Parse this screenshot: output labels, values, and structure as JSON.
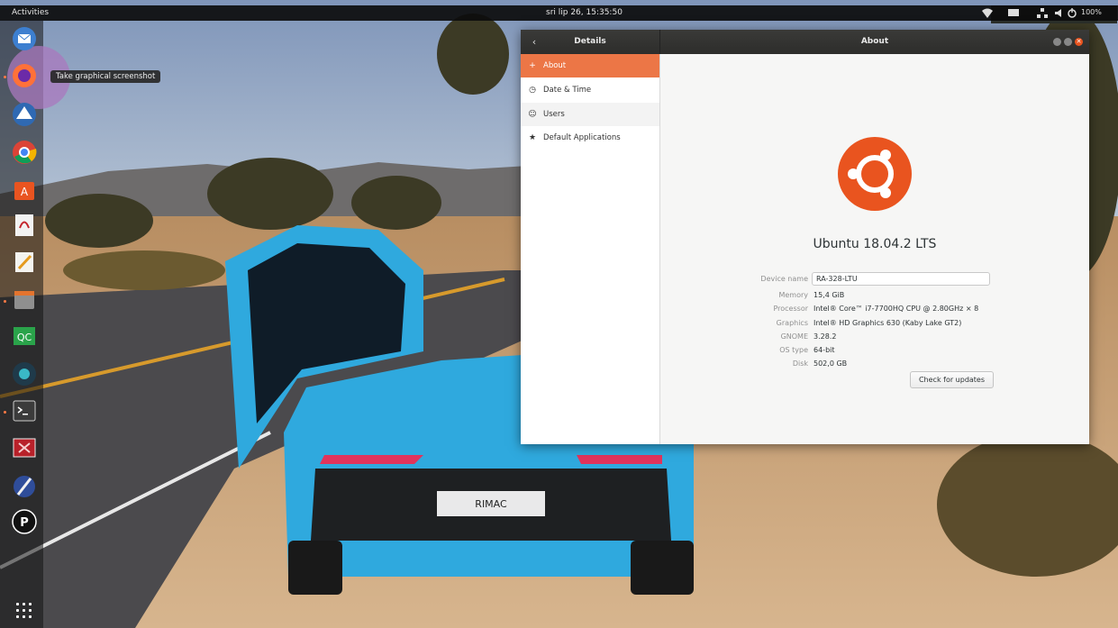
{
  "topbar": {
    "activities": "Activities",
    "clock": "sri lip 26, 15:35:50",
    "volume_label": "100%",
    "icons": [
      "network-icon",
      "display-icon",
      "wired-network-icon",
      "volume-icon",
      "power-icon"
    ]
  },
  "dock": {
    "tooltip": "Take graphical screenshot",
    "apps": [
      "thunderbird-icon",
      "firefox-icon",
      "inkscape-icon",
      "chrome-icon",
      "software-center-icon",
      "ebook-reader-icon",
      "text-editor-icon",
      "file-manager-icon",
      "qc-icon",
      "vpn-icon",
      "terminal-icon",
      "screenshot-tool-icon",
      "pencil-app-icon",
      "p-app-icon",
      "show-applications-icon"
    ],
    "qc_label": "QC",
    "p_label": "P"
  },
  "window": {
    "panel_title": "Details",
    "title": "About",
    "sidebar": [
      {
        "label": "About",
        "icon": "plus-icon",
        "glyph": "+"
      },
      {
        "label": "Date & Time",
        "icon": "clock-icon",
        "glyph": "◷"
      },
      {
        "label": "Users",
        "icon": "users-icon",
        "glyph": "☺"
      },
      {
        "label": "Default Applications",
        "icon": "star-icon",
        "glyph": "★"
      }
    ],
    "os_name": "Ubuntu 18.04.2 LTS",
    "device_name_label": "Device name",
    "device_name_value": "RA-328-LTU",
    "info": [
      {
        "label": "Memory",
        "value": "15,4 GiB"
      },
      {
        "label": "Processor",
        "value": "Intel® Core™ i7-7700HQ CPU @ 2.80GHz × 8"
      },
      {
        "label": "Graphics",
        "value": "Intel® HD Graphics 630 (Kaby Lake GT2)"
      },
      {
        "label": "GNOME",
        "value": "3.28.2"
      },
      {
        "label": "OS type",
        "value": "64-bit"
      },
      {
        "label": "Disk",
        "value": "502,0 GB"
      }
    ],
    "check_updates": "Check for updates"
  },
  "wallpaper": {
    "plate_text": "RIMAC"
  },
  "colors": {
    "accent": "#ec7646",
    "ubuntu_orange": "#e9541f",
    "car_blue": "#2fa9de"
  }
}
